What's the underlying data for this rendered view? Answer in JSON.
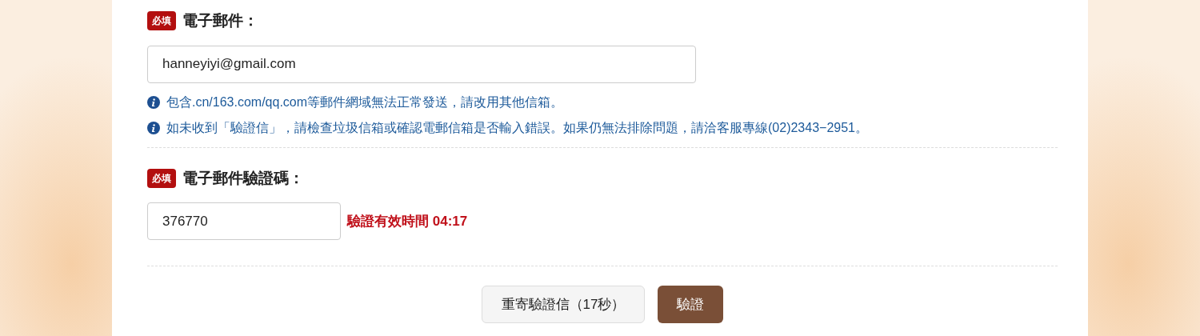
{
  "sections": [
    {
      "badge": "必填",
      "label": "電子郵件：",
      "field": {
        "value": "hanneyiyi@gmail.com",
        "kind": "email"
      },
      "notes": [
        "包含.cn/163.com/qq.com等郵件網域無法正常發送，請改用其他信箱。",
        "如未收到「驗證信」，請檢查垃圾信箱或確認電郵信箱是否輸入錯誤。如果仍無法排除問題，請洽客服專線(02)2343−2951。"
      ]
    },
    {
      "badge": "必填",
      "label": "電子郵件驗證碼：",
      "field": {
        "value": "376770",
        "kind": "code"
      },
      "timer": "驗證有效時間 04:17"
    }
  ],
  "buttons": [
    {
      "label": "重寄驗證信（17秒）",
      "kind": "secondary"
    },
    {
      "label": "驗證",
      "kind": "primary"
    }
  ]
}
